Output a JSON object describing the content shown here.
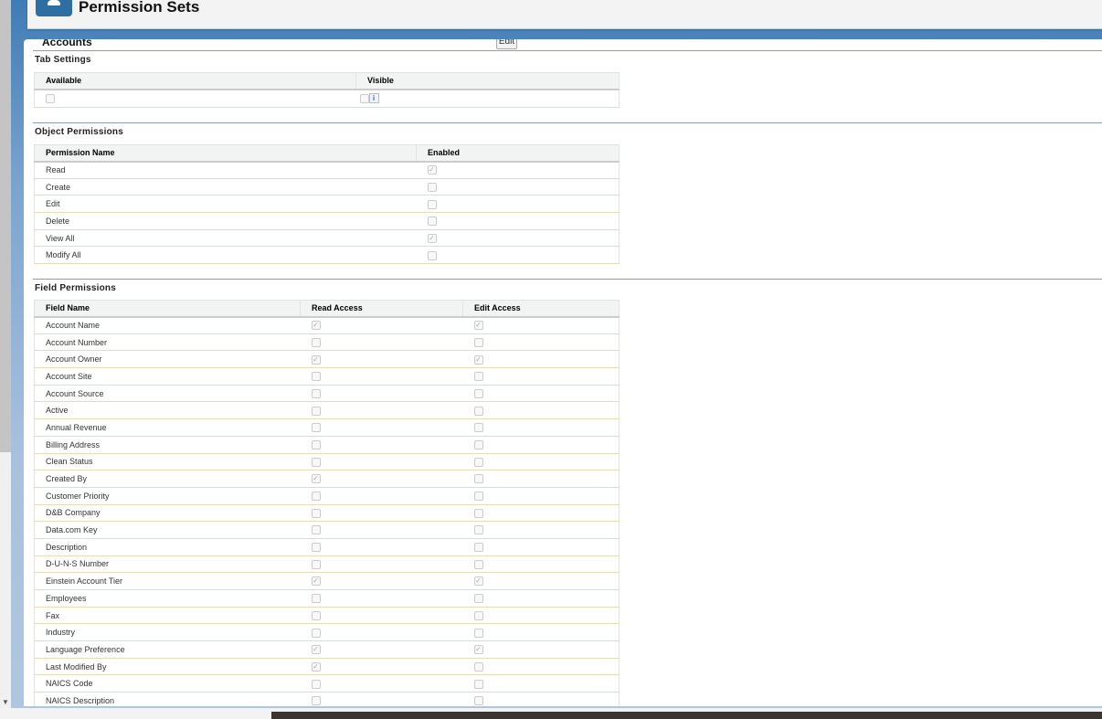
{
  "header": {
    "title": "Permission Sets"
  },
  "object": {
    "name": "Accounts",
    "edit_label": "Edit"
  },
  "tab_settings": {
    "title": "Tab Settings",
    "columns": [
      "Available",
      "Visible"
    ],
    "available": false,
    "visible": false,
    "info_label": "i"
  },
  "object_permissions": {
    "title": "Object Permissions",
    "columns": [
      "Permission Name",
      "Enabled"
    ],
    "rows": [
      {
        "name": "Read",
        "enabled": true
      },
      {
        "name": "Create",
        "enabled": false
      },
      {
        "name": "Edit",
        "enabled": false
      },
      {
        "name": "Delete",
        "enabled": false
      },
      {
        "name": "View All",
        "enabled": true
      },
      {
        "name": "Modify All",
        "enabled": false
      }
    ]
  },
  "field_permissions": {
    "title": "Field Permissions",
    "columns": [
      "Field Name",
      "Read Access",
      "Edit Access"
    ],
    "rows": [
      {
        "name": "Account Name",
        "read": true,
        "edit": true
      },
      {
        "name": "Account Number",
        "read": false,
        "edit": false
      },
      {
        "name": "Account Owner",
        "read": true,
        "edit": true
      },
      {
        "name": "Account Site",
        "read": false,
        "edit": false
      },
      {
        "name": "Account Source",
        "read": false,
        "edit": false
      },
      {
        "name": "Active",
        "read": false,
        "edit": false
      },
      {
        "name": "Annual Revenue",
        "read": false,
        "edit": false
      },
      {
        "name": "Billing Address",
        "read": false,
        "edit": false
      },
      {
        "name": "Clean Status",
        "read": false,
        "edit": false
      },
      {
        "name": "Created By",
        "read": true,
        "edit": false
      },
      {
        "name": "Customer Priority",
        "read": false,
        "edit": false
      },
      {
        "name": "D&B Company",
        "read": false,
        "edit": false
      },
      {
        "name": "Data.com Key",
        "read": false,
        "edit": false
      },
      {
        "name": "Description",
        "read": false,
        "edit": false
      },
      {
        "name": "D-U-N-S Number",
        "read": false,
        "edit": false
      },
      {
        "name": "Einstein Account Tier",
        "read": true,
        "edit": true
      },
      {
        "name": "Employees",
        "read": false,
        "edit": false
      },
      {
        "name": "Fax",
        "read": false,
        "edit": false
      },
      {
        "name": "Industry",
        "read": false,
        "edit": false
      },
      {
        "name": "Language Preference",
        "read": true,
        "edit": true
      },
      {
        "name": "Last Modified By",
        "read": true,
        "edit": false
      },
      {
        "name": "NAICS Code",
        "read": false,
        "edit": false
      },
      {
        "name": "NAICS Description",
        "read": false,
        "edit": false
      }
    ]
  }
}
